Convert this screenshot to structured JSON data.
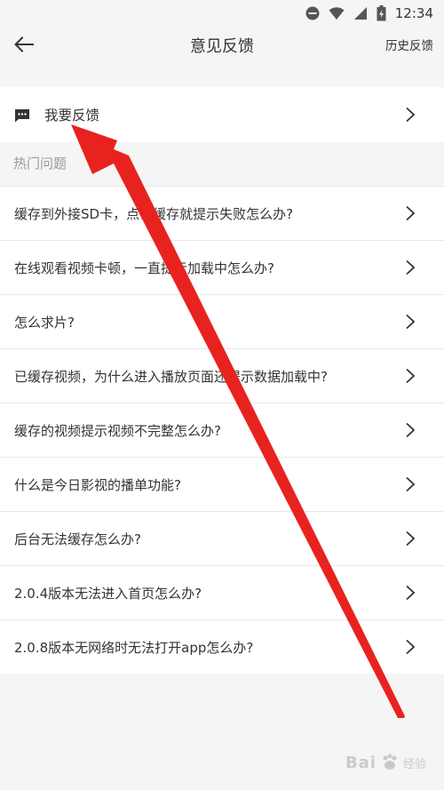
{
  "status_bar": {
    "time": "12:34",
    "icons": [
      "do-not-disturb-icon",
      "wifi-icon",
      "signal-icon",
      "battery-icon"
    ]
  },
  "app_bar": {
    "title": "意见反馈",
    "history_label": "历史反馈",
    "back_icon": "back-arrow-icon"
  },
  "feedback": {
    "label": "我要反馈",
    "icon": "chat-bubble-icon"
  },
  "hot_questions": {
    "header": "热门问题",
    "items": [
      "缓存到外接SD卡，点击缓存就提示失败怎么办?",
      "在线观看视频卡顿，一直提示加载中怎么办?",
      "怎么求片?",
      "已缓存视频，为什么进入播放页面还提示数据加载中?",
      "缓存的视频提示视频不完整怎么办?",
      "什么是今日影视的播单功能?",
      "后台无法缓存怎么办?",
      "2.0.4版本无法进入首页怎么办?",
      "2.0.8版本无网络时无法打开app怎么办?"
    ]
  },
  "watermark": {
    "brand": "Bai",
    "suffix": "经验"
  },
  "colors": {
    "background": "#f5f5f5",
    "card": "#ffffff",
    "text": "#333333",
    "muted": "#999999",
    "annotation": "#e8231f"
  }
}
